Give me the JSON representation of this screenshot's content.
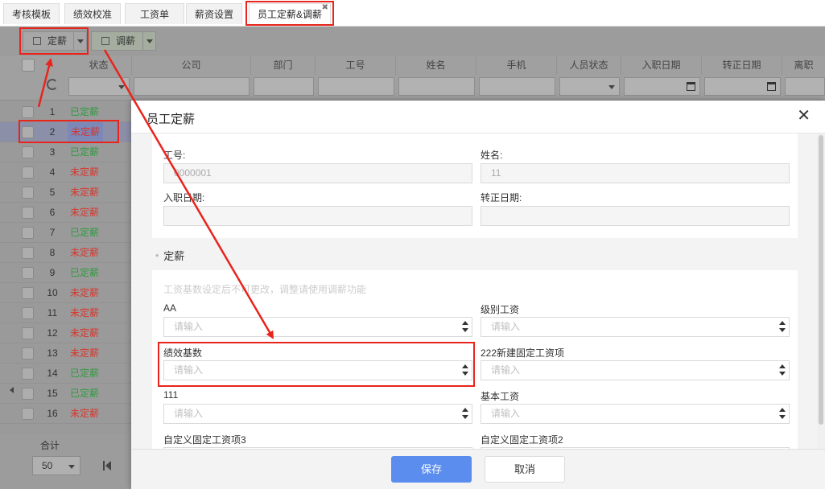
{
  "tabs": [
    {
      "label": "考核模板"
    },
    {
      "label": "绩效校准"
    },
    {
      "label": "工资单"
    },
    {
      "label": "薪资设置"
    },
    {
      "label": "员工定薪&调薪",
      "active": true
    }
  ],
  "toolbar": {
    "set_salary_label": "定薪",
    "adjust_salary_label": "调薪"
  },
  "grid": {
    "columns": [
      "状态",
      "公司",
      "部门",
      "工号",
      "姓名",
      "手机",
      "人员状态",
      "入职日期",
      "转正日期",
      "离职"
    ],
    "rows": [
      {
        "num": "1",
        "status": "已定薪",
        "set": true
      },
      {
        "num": "2",
        "status": "未定薪",
        "set": false,
        "selected": true
      },
      {
        "num": "3",
        "status": "已定薪",
        "set": true
      },
      {
        "num": "4",
        "status": "未定薪",
        "set": false
      },
      {
        "num": "5",
        "status": "未定薪",
        "set": false
      },
      {
        "num": "6",
        "status": "未定薪",
        "set": false
      },
      {
        "num": "7",
        "status": "已定薪",
        "set": true
      },
      {
        "num": "8",
        "status": "未定薪",
        "set": false
      },
      {
        "num": "9",
        "status": "已定薪",
        "set": true
      },
      {
        "num": "10",
        "status": "未定薪",
        "set": false
      },
      {
        "num": "11",
        "status": "未定薪",
        "set": false
      },
      {
        "num": "12",
        "status": "未定薪",
        "set": false
      },
      {
        "num": "13",
        "status": "未定薪",
        "set": false
      },
      {
        "num": "14",
        "status": "已定薪",
        "set": true
      },
      {
        "num": "15",
        "status": "已定薪",
        "set": true
      },
      {
        "num": "16",
        "status": "未定薪",
        "set": false
      }
    ],
    "footer": {
      "sum_label": "合计",
      "page_size": "50"
    }
  },
  "modal": {
    "title": "员工定薪",
    "close_symbol": "✕",
    "info": {
      "emp_no_label": "工号:",
      "emp_no_value": "0000001",
      "name_label": "姓名:",
      "name_value": "11",
      "hire_date_label": "入职日期:",
      "hire_date_value": "",
      "regular_date_label": "转正日期:",
      "regular_date_value": ""
    },
    "section_title": "定薪",
    "hint": "工资基数设定后不可更改，调整请使用调薪功能",
    "fields": [
      {
        "label": "AA",
        "placeholder": "请输入"
      },
      {
        "label": "级别工资",
        "placeholder": "请输入"
      },
      {
        "label": "绩效基数",
        "placeholder": "请输入"
      },
      {
        "label": "222新建固定工资项",
        "placeholder": "请输入"
      },
      {
        "label": "111",
        "placeholder": "请输入"
      },
      {
        "label": "基本工资",
        "placeholder": "请输入"
      },
      {
        "label": "自定义固定工资项3",
        "placeholder": ""
      },
      {
        "label": "自定义固定工资项2",
        "placeholder": ""
      }
    ],
    "save_label": "保存",
    "cancel_label": "取消"
  },
  "colors": {
    "status_set": "#2e9b3e",
    "status_unset": "#d9342b",
    "primary": "#5b8def",
    "annotation": "#e8241c"
  }
}
